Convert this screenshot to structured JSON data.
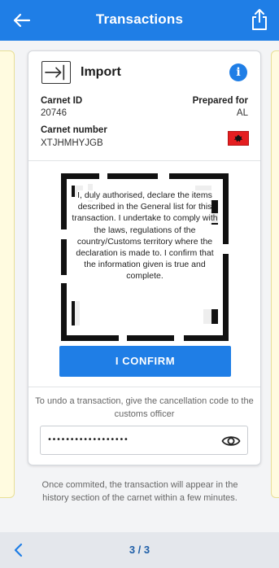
{
  "header": {
    "title": "Transactions",
    "back_icon": "arrow-left-icon",
    "share_icon": "share-icon",
    "background": "#1f7ee6"
  },
  "card": {
    "type_label": "Import",
    "type_icon": "import-arrow-icon",
    "info_icon": "info-icon",
    "carnet_id_label": "Carnet ID",
    "carnet_id_value": "20746",
    "prepared_for_label": "Prepared for",
    "prepared_for_value": "AL",
    "carnet_number_label": "Carnet number",
    "carnet_number_value": "XTJHMHYJGB",
    "flag_icon": "albania-flag-icon",
    "declaration": "I, duly authorised, declare the items described in the General list for this transaction. I undertake to comply with the laws, regulations of the country/Customs territory where the declaration is made to. I confirm that the information given is true and complete.",
    "confirm_label": "I CONFIRM",
    "undo_text": "To undo a transaction, give the cancellation code to the customs officer",
    "cancellation_code_masked": "••••••••••••••••••",
    "visibility_icon": "eye-icon"
  },
  "footnote": "Once commited, the transaction will appear in the history section of the carnet within a few minutes.",
  "pager": {
    "prev_icon": "chevron-left-icon",
    "label": "3 / 3"
  },
  "colors": {
    "accent": "#1f7ee6",
    "side_card": "#fffbe0",
    "flag_red": "#e41e20"
  }
}
